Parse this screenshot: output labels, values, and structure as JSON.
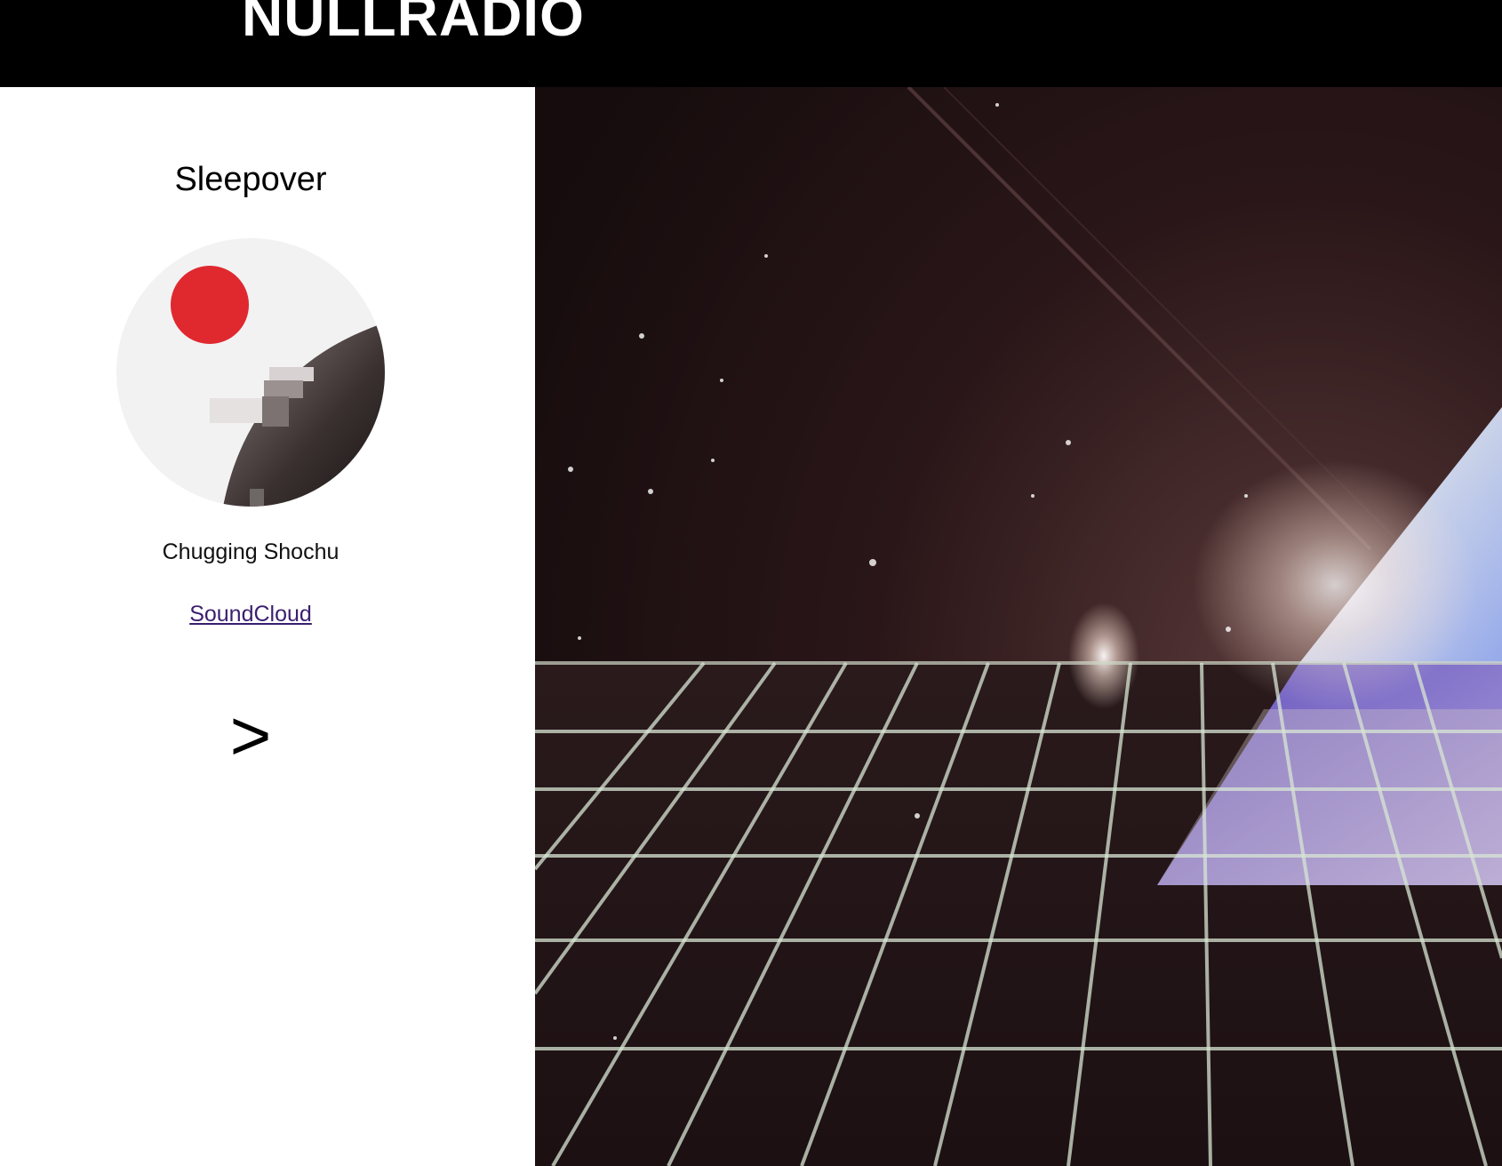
{
  "header": {
    "brand": "NULLRADIO"
  },
  "show": {
    "title": "Sleepover",
    "track": "Chugging Shochu",
    "link_label": "SoundCloud",
    "next_label": ">"
  },
  "colors": {
    "header_bg": "#000000",
    "brand_text": "#ffffff",
    "link": "#3b1f6e",
    "cover_sun": "#e0282f",
    "visual_bg": "#1b0f10",
    "grid": "#d8e6d4"
  },
  "icons": {
    "cover": "album-cover-art",
    "next": "next-arrow-icon",
    "visual": "synthwave-grid-artwork"
  }
}
